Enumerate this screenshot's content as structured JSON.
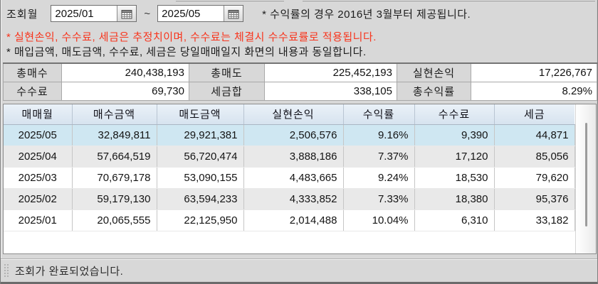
{
  "filter": {
    "label": "조회월",
    "date_from": "2025/01",
    "date_to": "2025/05",
    "separator": "~",
    "note": "* 수익률의 경우 2016년 3월부터 제공됩니다."
  },
  "notices": {
    "estimate_notice": "* 실현손익, 수수료, 세금은 추정치이며, 수수료는 체결시 수수료률로 적용됩니다.",
    "match_notice": "* 매입금액, 매도금액, 수수료, 세금은 당일매매일지 화면의 내용과 동일합니다."
  },
  "summary": {
    "total_buy": {
      "label": "총매수",
      "value": "240,438,193"
    },
    "total_sell": {
      "label": "총매도",
      "value": "225,452,193"
    },
    "realized_pl": {
      "label": "실현손익",
      "value": "17,226,767"
    },
    "fee": {
      "label": "수수료",
      "value": "69,730"
    },
    "tax_total": {
      "label": "세금합",
      "value": "338,105"
    },
    "total_return": {
      "label": "총수익률",
      "value": "8.29%"
    }
  },
  "grid": {
    "headers": [
      "매매월",
      "매수금액",
      "매도금액",
      "실현손익",
      "수익률",
      "수수료",
      "세금"
    ],
    "rows": [
      {
        "month": "2025/05",
        "buy": "32,849,811",
        "sell": "29,921,381",
        "realized_pl": "2,506,576",
        "return_rate": "9.16%",
        "fee": "9,390",
        "tax": "44,871"
      },
      {
        "month": "2025/04",
        "buy": "57,664,519",
        "sell": "56,720,474",
        "realized_pl": "3,888,186",
        "return_rate": "7.37%",
        "fee": "17,120",
        "tax": "85,056"
      },
      {
        "month": "2025/03",
        "buy": "70,679,178",
        "sell": "53,090,155",
        "realized_pl": "4,483,665",
        "return_rate": "9.24%",
        "fee": "18,530",
        "tax": "79,620"
      },
      {
        "month": "2025/02",
        "buy": "59,179,130",
        "sell": "63,594,233",
        "realized_pl": "4,333,852",
        "return_rate": "7.33%",
        "fee": "18,380",
        "tax": "95,376"
      },
      {
        "month": "2025/01",
        "buy": "20,065,555",
        "sell": "22,125,950",
        "realized_pl": "2,014,488",
        "return_rate": "10.04%",
        "fee": "6,310",
        "tax": "33,182"
      }
    ]
  },
  "status_bar": {
    "message": "조회가 완료되었습니다."
  },
  "colors": {
    "accent_red": "#f8341c",
    "grid_header_bg": "#dde8f2",
    "selected_row_bg": "#cfe7f2",
    "window_bg": "#d8d8d8"
  }
}
